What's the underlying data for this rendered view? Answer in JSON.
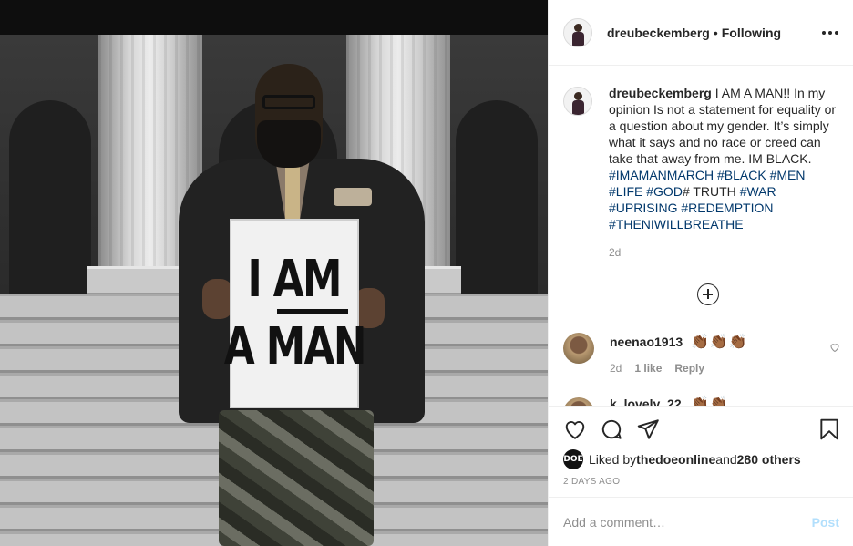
{
  "header": {
    "username": "dreubeckemberg",
    "separator": "•",
    "follow_status": "Following",
    "more_icon": "more-horizontal-icon"
  },
  "media": {
    "sign_line1": "I AM",
    "sign_line2": "A MAN"
  },
  "caption": {
    "username": "dreubeckemberg",
    "text_before": " I AM A MAN!! In my opinion Is not a statement for equality or a question about my gender. It’s simply what it says and no race or creed can take that away from me. IM BLACK. ",
    "tags": [
      "#IMAMANMARCH",
      "#BLACK",
      "#MEN",
      "#LIFE",
      "#GOD"
    ],
    "mid_text": "# TRUTH ",
    "tags2": [
      "#WAR",
      "#UPRISING",
      "#REDEMPTION",
      "#THENIWILLBREATHE"
    ],
    "time": "2d"
  },
  "load_more_icon": "plus-circle-icon",
  "comments": [
    {
      "username": "neenao1913",
      "text": "👏🏾👏🏾👏🏾",
      "time": "2d",
      "likes": "1 like",
      "reply": "Reply"
    },
    {
      "username": "k_lovely_22",
      "text": "👏🏾👏🏾"
    }
  ],
  "actions": {
    "like_icon": "heart-icon",
    "comment_icon": "comment-icon",
    "share_icon": "paper-plane-icon",
    "save_icon": "bookmark-icon",
    "liked_by_prefix": "Liked by ",
    "liked_by_user": "thedoeonline",
    "liked_by_and": " and ",
    "liked_by_others": "280 others",
    "likes_avatar_text": "DOE",
    "post_time": "2 DAYS AGO"
  },
  "add_comment": {
    "placeholder": "Add a comment…",
    "post_label": "Post"
  },
  "colors": {
    "link": "#00376b",
    "secondary_text": "#8e8e8e",
    "post_button_disabled": "#b2dffc",
    "border": "#efefef"
  }
}
